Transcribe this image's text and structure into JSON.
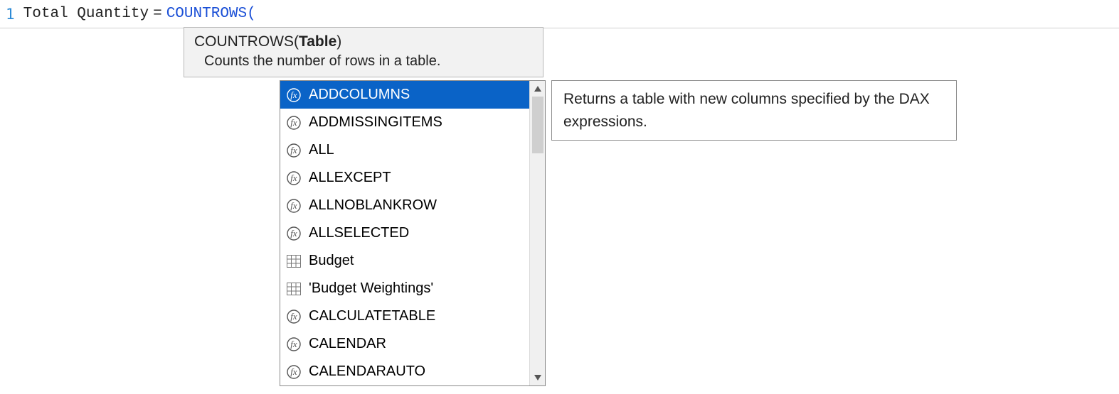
{
  "formula": {
    "line_number": "1",
    "measure_name": "Total Quantity",
    "equals": "=",
    "function": "COUNTROWS",
    "paren": "("
  },
  "signature_tooltip": {
    "func": "COUNTROWS(",
    "bold_arg": "Table",
    "close": ")",
    "description": "Counts the number of rows in a table."
  },
  "intellisense": {
    "items": [
      {
        "type": "fx",
        "label": "ADDCOLUMNS",
        "selected": true
      },
      {
        "type": "fx",
        "label": "ADDMISSINGITEMS",
        "selected": false
      },
      {
        "type": "fx",
        "label": "ALL",
        "selected": false
      },
      {
        "type": "fx",
        "label": "ALLEXCEPT",
        "selected": false
      },
      {
        "type": "fx",
        "label": "ALLNOBLANKROW",
        "selected": false
      },
      {
        "type": "fx",
        "label": "ALLSELECTED",
        "selected": false
      },
      {
        "type": "table",
        "label": "Budget",
        "selected": false
      },
      {
        "type": "table",
        "label": "'Budget Weightings'",
        "selected": false
      },
      {
        "type": "fx",
        "label": "CALCULATETABLE",
        "selected": false
      },
      {
        "type": "fx",
        "label": "CALENDAR",
        "selected": false
      },
      {
        "type": "fx",
        "label": "CALENDARAUTO",
        "selected": false
      }
    ]
  },
  "description_panel": {
    "text": "Returns a table with new columns specified by the DAX expressions."
  }
}
